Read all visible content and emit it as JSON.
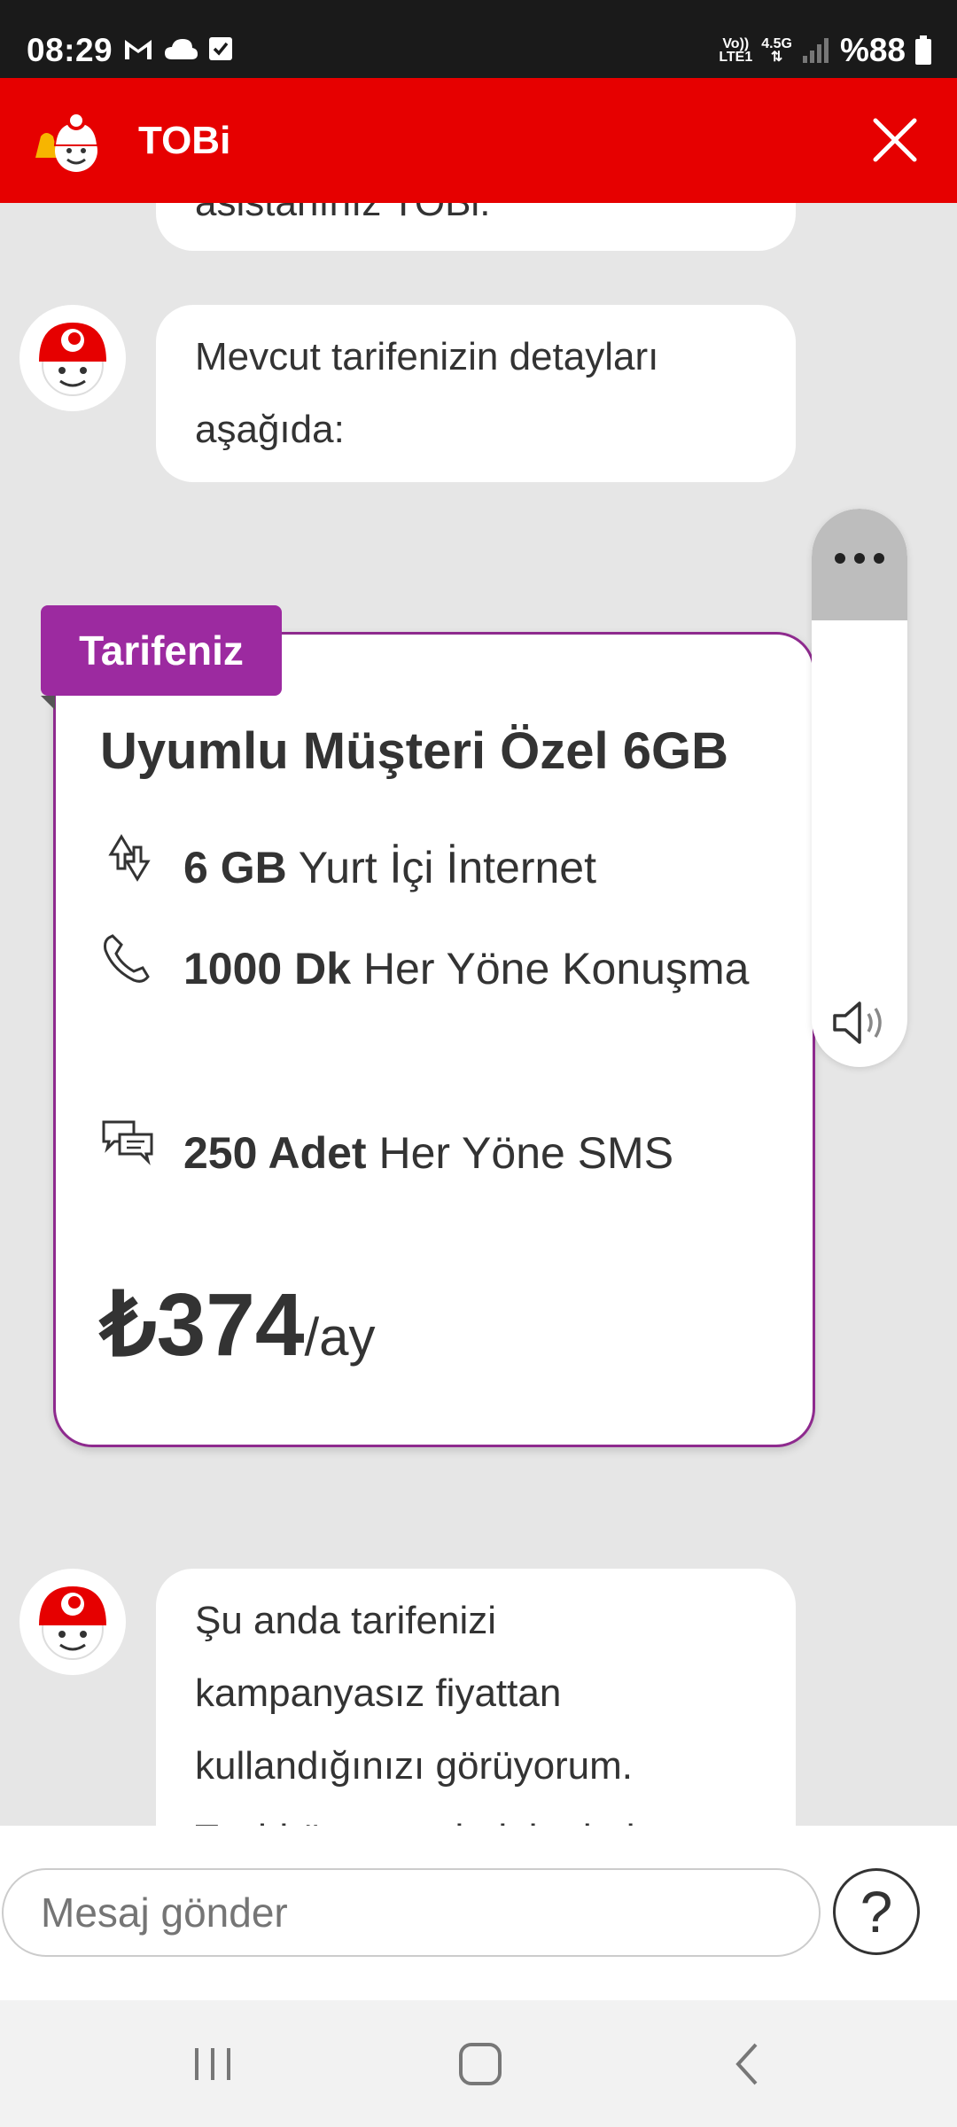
{
  "status_bar": {
    "time": "08:29",
    "network_top": "Vo))",
    "network_bottom": "LTE1",
    "network_type": "4.5G",
    "battery": "%88"
  },
  "header": {
    "title": "TOBi"
  },
  "messages": [
    {
      "text": "asistanınız TOBi."
    },
    {
      "text": "Mevcut tarifenizin detayları aşağıda:"
    },
    {
      "text": "Şu anda tarifenizi kampanyasız fiyattan kullandığınızı görüyorum. Taahhüt vererek daha bol"
    }
  ],
  "tariff_card": {
    "tag": "Tarifeniz",
    "title": "Uyumlu Müşteri Özel 6GB",
    "features": [
      {
        "icon": "data-transfer-icon",
        "bold": "6 GB",
        "text": "Yurt İçi İnternet"
      },
      {
        "icon": "phone-icon",
        "bold": "1000 Dk",
        "text": "Her Yöne Konuşma"
      },
      {
        "icon": "sms-icon",
        "bold": "250 Adet",
        "text": "Her Yöne SMS"
      }
    ],
    "price": "₺374",
    "price_unit": "/ay"
  },
  "input": {
    "placeholder": "Mesaj gönder",
    "help_label": "?"
  },
  "colors": {
    "brand_red": "#e60000",
    "tariff_purple": "#9c2aa0"
  }
}
